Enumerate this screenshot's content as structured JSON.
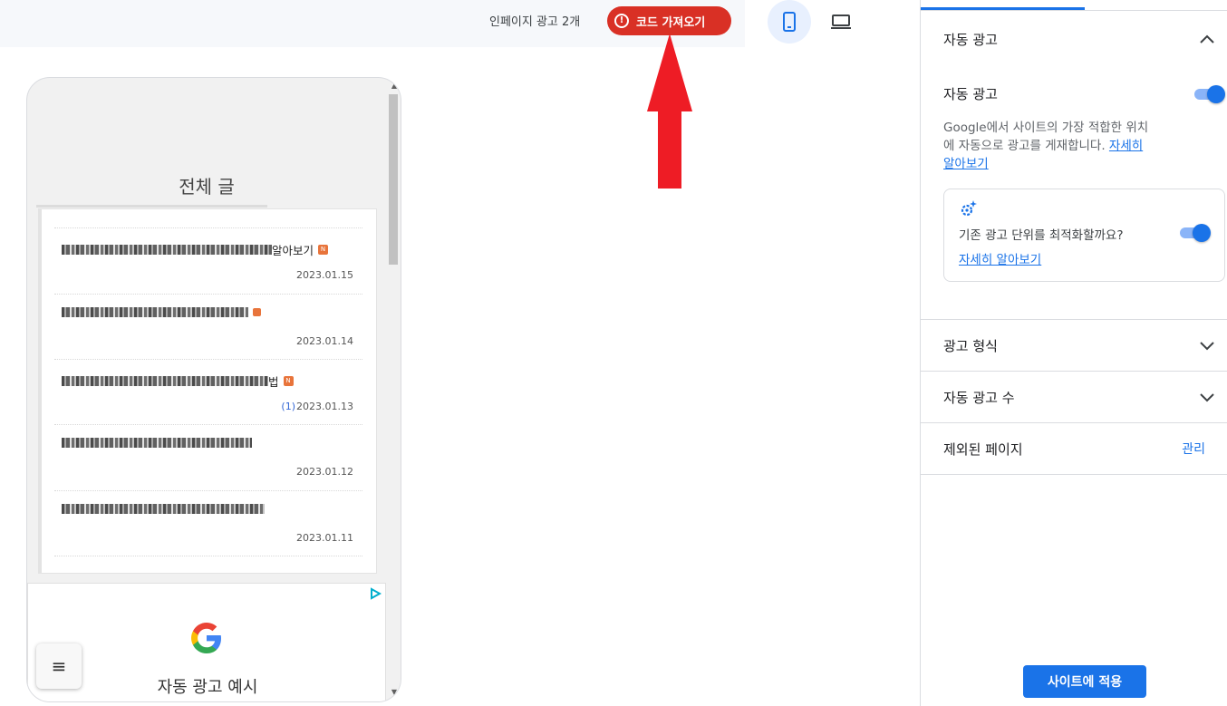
{
  "topbar": {
    "ad_count": "인페이지 광고 2개",
    "get_code_label": "코드 가져오기",
    "device_mobile_icon": "smartphone-icon",
    "device_desktop_icon": "laptop-icon"
  },
  "preview": {
    "heading": "전체 글",
    "posts": [
      {
        "title_visible": "알아보기",
        "new_badge": "N",
        "comments": "",
        "date": "2023.01.15"
      },
      {
        "title_visible": "",
        "new_badge": "",
        "comments": "",
        "date": "2023.01.14"
      },
      {
        "title_visible": "법",
        "new_badge": "N",
        "comments": "(1)",
        "date": "2023.01.13"
      },
      {
        "title_visible": "",
        "new_badge": "",
        "comments": "",
        "date": "2023.01.12"
      },
      {
        "title_visible": "",
        "new_badge": "",
        "comments": "",
        "date": "2023.01.11"
      }
    ],
    "ad_example_label": "자동 광고 예시",
    "menu_icon": "hamburger-icon"
  },
  "panel": {
    "section_auto_ads": "자동 광고",
    "auto_ads_toggle_label": "자동 광고",
    "auto_ads_enabled": true,
    "description_line1": "Google에서 사이트의 가장 적합한 위치",
    "description_line2": "에 자동으로 광고를 게재합니다.",
    "learn_more_1": "자세히",
    "learn_more_2": "알아보기",
    "optimize_label": "기존 광고 단위를 최적화할까요?",
    "optimize_enabled": true,
    "optimize_more": "자세히 알아보기",
    "section_ad_formats": "광고 형식",
    "section_ad_load": "자동 광고 수",
    "section_excluded_pages": "제외된 페이지",
    "manage_label": "관리",
    "apply_button": "사이트에 적용"
  },
  "colors": {
    "accent": "#1a73e8",
    "warning": "#d93025",
    "annotation_arrow": "#ee1c25"
  }
}
